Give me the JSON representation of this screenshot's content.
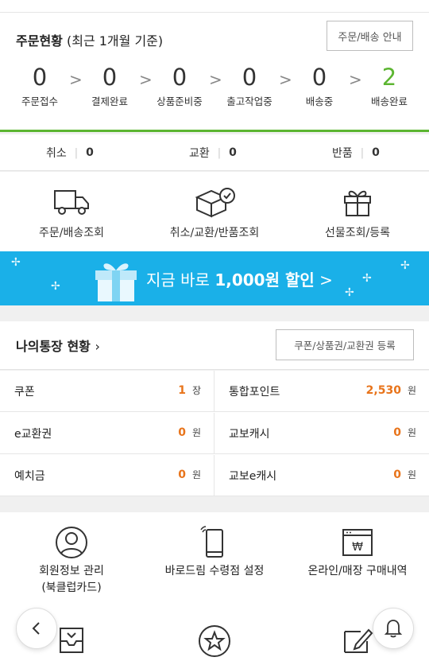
{
  "order": {
    "title_main": "주문현황",
    "title_sub": "(최근 1개월 기준)",
    "guide_button": "주문/배송 안내",
    "steps": [
      {
        "count": "0",
        "label": "주문접수"
      },
      {
        "count": "0",
        "label": "결제완료"
      },
      {
        "count": "0",
        "label": "상품준비중"
      },
      {
        "count": "0",
        "label": "출고작업중"
      },
      {
        "count": "0",
        "label": "배송중"
      },
      {
        "count": "2",
        "label": "배송완료"
      }
    ],
    "accent_color": "#5cb531"
  },
  "claims": [
    {
      "label": "취소",
      "count": "0"
    },
    {
      "label": "교환",
      "count": "0"
    },
    {
      "label": "반품",
      "count": "0"
    }
  ],
  "quick_links": [
    {
      "label": "주문/배송조회",
      "icon": "truck-icon"
    },
    {
      "label": "취소/교환/반품조회",
      "icon": "box-return-icon"
    },
    {
      "label": "선물조회/등록",
      "icon": "gift-icon"
    }
  ],
  "banner": {
    "text_pre": "지금 바로 ",
    "text_bold": "1,000원 할인",
    "text_arrow": " >",
    "bg_color": "#1ab0e8"
  },
  "wallet": {
    "title": "나의통장 현황",
    "title_arrow": "›",
    "register_button": "쿠폰/상품권/교환권 등록",
    "items": [
      {
        "label": "쿠폰",
        "value": "1",
        "unit": "장"
      },
      {
        "label": "통합포인트",
        "value": "2,530",
        "unit": "원"
      },
      {
        "label": "e교환권",
        "value": "0",
        "unit": "원"
      },
      {
        "label": "교보캐시",
        "value": "0",
        "unit": "원"
      },
      {
        "label": "예치금",
        "value": "0",
        "unit": "원"
      },
      {
        "label": "교보e캐시",
        "value": "0",
        "unit": "원"
      }
    ],
    "value_color": "#e8741b"
  },
  "member": {
    "items": [
      {
        "line1": "회원정보 관리",
        "line2": "(북클럽카드)",
        "icon": "user-circle-icon"
      },
      {
        "line1": "바로드림 수령점 설정",
        "line2": "",
        "icon": "smartphone-icon"
      },
      {
        "line1": "온라인/매장 구매내역",
        "line2": "",
        "icon": "won-receipt-icon"
      }
    ],
    "second_row_icons": [
      "inbox-icon",
      "star-circle-icon",
      "write-icon"
    ]
  },
  "fabs": {
    "back": "back-chevron-icon",
    "notify": "bell-icon"
  }
}
